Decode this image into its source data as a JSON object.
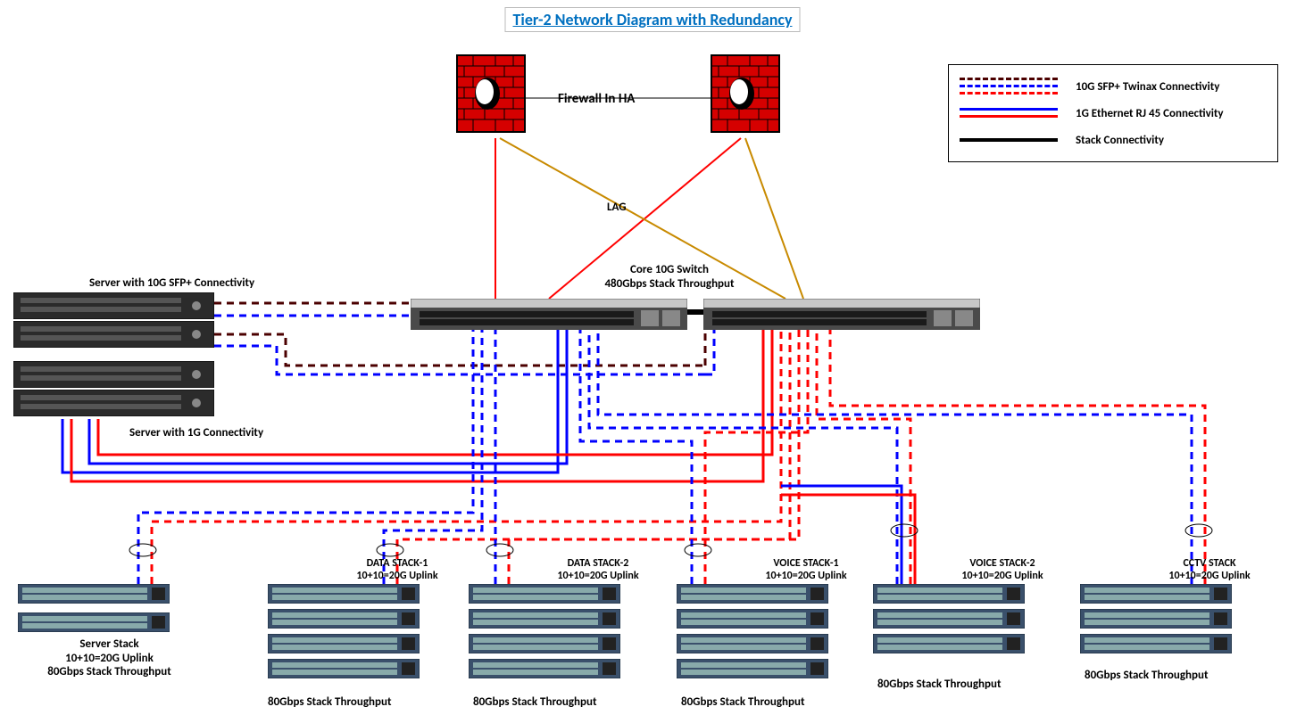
{
  "title": "Tier-2 Network Diagram with Redundancy",
  "firewall_label": "Firewall In HA",
  "lag_label": "LAG",
  "core_switch": {
    "label_line1": "Core 10G Switch",
    "label_line2": "480Gbps Stack Throughput"
  },
  "server_sfp_label": "Server with 10G SFP+ Connectivity",
  "server_1g_label": "Server with 1G Connectivity",
  "legend": {
    "twinax": "10G SFP+ Twinax Connectivity",
    "ethernet": "1G Ethernet RJ 45 Connectivity",
    "stack": "Stack Connectivity"
  },
  "stacks": [
    {
      "name": "Server Stack",
      "uplink": "10+10=20G Uplink",
      "throughput": "80Gbps Stack Throughput"
    },
    {
      "name": "DATA STACK-1",
      "uplink": "10+10=20G Uplink",
      "throughput": "80Gbps Stack Throughput"
    },
    {
      "name": "DATA STACK-2",
      "uplink": "10+10=20G Uplink",
      "throughput": "80Gbps Stack Throughput"
    },
    {
      "name": "VOICE STACK-1",
      "uplink": "10+10=20G Uplink",
      "throughput": "80Gbps Stack Throughput"
    },
    {
      "name": "VOICE STACK-2",
      "uplink": "10+10=20G Uplink",
      "throughput": "80Gbps Stack Throughput"
    },
    {
      "name": "CCTV STACK",
      "uplink": "10+10=20G Uplink",
      "throughput": "80Gbps Stack Throughput"
    }
  ]
}
